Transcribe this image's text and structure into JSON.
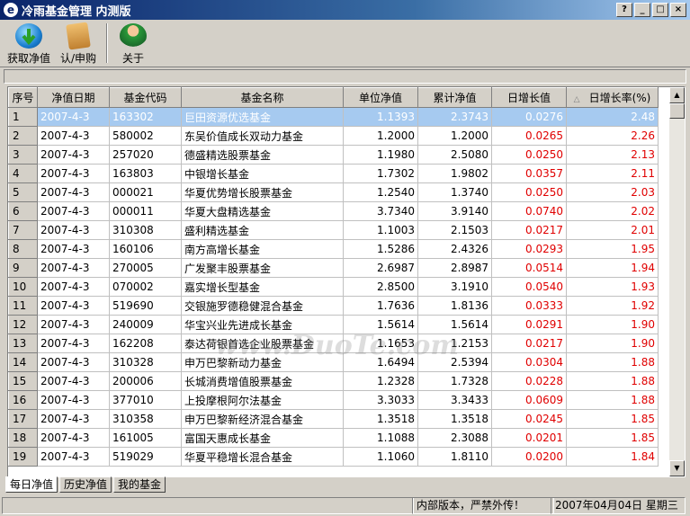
{
  "window": {
    "title": "冷雨基金管理  内测版",
    "app_icon": "e-logo-icon",
    "controls": [
      "?",
      "_",
      "□",
      "×"
    ]
  },
  "toolbar": {
    "fetch_nav_label": "获取净值",
    "subscribe_label": "认/申购",
    "about_label": "关于"
  },
  "table": {
    "headers": [
      "序号",
      "净值日期",
      "基金代码",
      "基金名称",
      "单位净值",
      "累计净值",
      "日增长值",
      "日增长率(%)"
    ],
    "rows": [
      {
        "no": "1",
        "date": "2007-4-3",
        "code": "163302",
        "name": "巨田资源优选基金",
        "unit": "1.1393",
        "cum": "2.3743",
        "inc": "0.0276",
        "rate": "2.48"
      },
      {
        "no": "2",
        "date": "2007-4-3",
        "code": "580002",
        "name": "东吴价值成长双动力基金",
        "unit": "1.2000",
        "cum": "1.2000",
        "inc": "0.0265",
        "rate": "2.26"
      },
      {
        "no": "3",
        "date": "2007-4-3",
        "code": "257020",
        "name": "德盛精选股票基金",
        "unit": "1.1980",
        "cum": "2.5080",
        "inc": "0.0250",
        "rate": "2.13"
      },
      {
        "no": "4",
        "date": "2007-4-3",
        "code": "163803",
        "name": "中银增长基金",
        "unit": "1.7302",
        "cum": "1.9802",
        "inc": "0.0357",
        "rate": "2.11"
      },
      {
        "no": "5",
        "date": "2007-4-3",
        "code": "000021",
        "name": "华夏优势增长股票基金",
        "unit": "1.2540",
        "cum": "1.3740",
        "inc": "0.0250",
        "rate": "2.03"
      },
      {
        "no": "6",
        "date": "2007-4-3",
        "code": "000011",
        "name": "华夏大盘精选基金",
        "unit": "3.7340",
        "cum": "3.9140",
        "inc": "0.0740",
        "rate": "2.02"
      },
      {
        "no": "7",
        "date": "2007-4-3",
        "code": "310308",
        "name": "盛利精选基金",
        "unit": "1.1003",
        "cum": "2.1503",
        "inc": "0.0217",
        "rate": "2.01"
      },
      {
        "no": "8",
        "date": "2007-4-3",
        "code": "160106",
        "name": "南方高增长基金",
        "unit": "1.5286",
        "cum": "2.4326",
        "inc": "0.0293",
        "rate": "1.95"
      },
      {
        "no": "9",
        "date": "2007-4-3",
        "code": "270005",
        "name": "广发聚丰股票基金",
        "unit": "2.6987",
        "cum": "2.8987",
        "inc": "0.0514",
        "rate": "1.94"
      },
      {
        "no": "10",
        "date": "2007-4-3",
        "code": "070002",
        "name": "嘉实增长型基金",
        "unit": "2.8500",
        "cum": "3.1910",
        "inc": "0.0540",
        "rate": "1.93"
      },
      {
        "no": "11",
        "date": "2007-4-3",
        "code": "519690",
        "name": "交银施罗德稳健混合基金",
        "unit": "1.7636",
        "cum": "1.8136",
        "inc": "0.0333",
        "rate": "1.92"
      },
      {
        "no": "12",
        "date": "2007-4-3",
        "code": "240009",
        "name": "华宝兴业先进成长基金",
        "unit": "1.5614",
        "cum": "1.5614",
        "inc": "0.0291",
        "rate": "1.90"
      },
      {
        "no": "13",
        "date": "2007-4-3",
        "code": "162208",
        "name": "泰达荷银首选企业股票基金",
        "unit": "1.1653",
        "cum": "1.2153",
        "inc": "0.0217",
        "rate": "1.90"
      },
      {
        "no": "14",
        "date": "2007-4-3",
        "code": "310328",
        "name": "申万巴黎新动力基金",
        "unit": "1.6494",
        "cum": "2.5394",
        "inc": "0.0304",
        "rate": "1.88"
      },
      {
        "no": "15",
        "date": "2007-4-3",
        "code": "200006",
        "name": "长城消费增值股票基金",
        "unit": "1.2328",
        "cum": "1.7328",
        "inc": "0.0228",
        "rate": "1.88"
      },
      {
        "no": "16",
        "date": "2007-4-3",
        "code": "377010",
        "name": "上投摩根阿尔法基金",
        "unit": "3.3033",
        "cum": "3.3433",
        "inc": "0.0609",
        "rate": "1.88"
      },
      {
        "no": "17",
        "date": "2007-4-3",
        "code": "310358",
        "name": "申万巴黎新经济混合基金",
        "unit": "1.3518",
        "cum": "1.3518",
        "inc": "0.0245",
        "rate": "1.85"
      },
      {
        "no": "18",
        "date": "2007-4-3",
        "code": "161005",
        "name": "富国天惠成长基金",
        "unit": "1.1088",
        "cum": "2.3088",
        "inc": "0.0201",
        "rate": "1.85"
      },
      {
        "no": "19",
        "date": "2007-4-3",
        "code": "519029",
        "name": "华夏平稳增长混合基金",
        "unit": "1.1060",
        "cum": "1.8110",
        "inc": "0.0200",
        "rate": "1.84"
      }
    ]
  },
  "tabs": [
    "每日净值",
    "历史净值",
    "我的基金"
  ],
  "status": {
    "left": "",
    "notice": "内部版本，严禁外传！",
    "date": "2007年04月04日   星期三"
  },
  "watermark": "www.DuoTe.com",
  "colors": {
    "title_bar": "#0a246a",
    "selected_row": "#a6caf0",
    "change_red": "#e00000"
  }
}
